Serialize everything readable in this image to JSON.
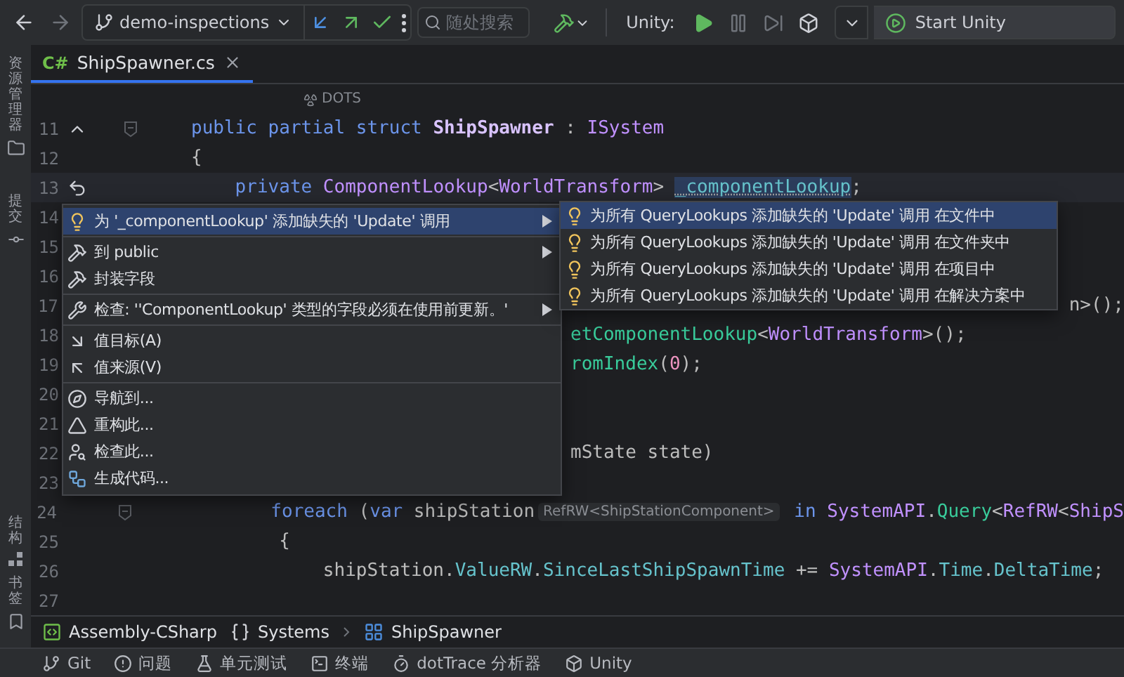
{
  "toolbar": {
    "branch": "demo-inspections",
    "search": {
      "placeholder": "随处搜索"
    },
    "unity_label": "Unity:",
    "start_button": "Start Unity"
  },
  "left_strip": [
    {
      "label": "资源管理器",
      "kind": "explorer"
    },
    {
      "label": "提交",
      "kind": "commit"
    },
    {
      "label": "结构",
      "kind": "structure"
    },
    {
      "label": "书签",
      "kind": "bookmarks"
    }
  ],
  "tabs": [
    {
      "badge": "C#",
      "label": "ShipSpawner.cs",
      "selected": true
    }
  ],
  "code_vision": "DOTS",
  "code_lines": [
    {
      "number": "11",
      "current": false,
      "kind": "implements",
      "tokens": [
        {
          "t": "public partial struct ",
          "kind": "kw"
        },
        {
          "t": "ShipSpawner",
          "kind": "decl"
        },
        {
          "t": " : ",
          "kind": "plain"
        },
        {
          "t": "ISystem",
          "kind": "type"
        }
      ]
    },
    {
      "number": "12",
      "current": false,
      "kind": "plain",
      "tokens": [
        {
          "t": "{",
          "kind": "plain"
        }
      ]
    },
    {
      "number": "13",
      "current": true,
      "kind": "revert",
      "tokens": [
        {
          "t": "    private ",
          "kind": "kw"
        },
        {
          "t": "ComponentLookup",
          "kind": "type"
        },
        {
          "t": "<",
          "kind": "plain"
        },
        {
          "t": "WorldTransform",
          "kind": "type"
        },
        {
          "t": "> ",
          "kind": "plain"
        },
        {
          "t": "_componentLookup",
          "kind": "field_hl"
        },
        {
          "t": ";",
          "kind": "plain"
        }
      ]
    },
    {
      "number": "14",
      "current": false,
      "kind": "plain"
    },
    {
      "number": "15",
      "current": false,
      "kind": "plain"
    },
    {
      "number": "16",
      "current": false,
      "kind": "plain"
    },
    {
      "number": "17",
      "current": false,
      "kind": "after_submenu",
      "tokens": [
        {
          "t": "n>();",
          "kind": "plain"
        }
      ]
    },
    {
      "number": "18",
      "current": false,
      "kind": "after_menu",
      "tokens": [
        {
          "t": "etComponentLookup",
          "kind": "method"
        },
        {
          "t": "<",
          "kind": "plain"
        },
        {
          "t": "WorldTransform",
          "kind": "type"
        },
        {
          "t": ">();",
          "kind": "plain"
        }
      ]
    },
    {
      "number": "19",
      "current": false,
      "kind": "after_menu",
      "tokens": [
        {
          "t": "romIndex",
          "kind": "method"
        },
        {
          "t": "(",
          "kind": "plain"
        },
        {
          "t": "0",
          "kind": "num"
        },
        {
          "t": ");",
          "kind": "plain"
        }
      ]
    },
    {
      "number": "20",
      "current": false,
      "kind": "plain"
    },
    {
      "number": "21",
      "current": false,
      "kind": "plain"
    },
    {
      "number": "22",
      "current": false,
      "kind": "after_menu",
      "tokens": [
        {
          "t": "mState state)",
          "kind": "plain"
        }
      ]
    },
    {
      "number": "23",
      "current": false,
      "kind": "plain"
    },
    {
      "number": "24",
      "current": false,
      "kind": "block",
      "tokens": [
        {
          "t": "        foreach",
          "kind": "kw"
        },
        {
          "t": " (",
          "kind": "plain"
        },
        {
          "t": "var",
          "kind": "kw"
        },
        {
          "t": " shipStation",
          "kind": "plain"
        },
        {
          "t": "RefRW<ShipStationComponent>",
          "kind": "hint"
        },
        {
          "t": " in ",
          "kind": "kw"
        },
        {
          "t": "SystemAPI",
          "kind": "type"
        },
        {
          "t": ".",
          "kind": "plain"
        },
        {
          "t": "Query",
          "kind": "method"
        },
        {
          "t": "<",
          "kind": "plain"
        },
        {
          "t": "RefRW",
          "kind": "type"
        },
        {
          "t": "<",
          "kind": "plain"
        },
        {
          "t": "ShipS",
          "kind": "type"
        }
      ]
    },
    {
      "number": "25",
      "current": false,
      "kind": "plain",
      "tokens": [
        {
          "t": "        {",
          "kind": "plain"
        }
      ]
    },
    {
      "number": "26",
      "current": false,
      "kind": "plain",
      "tokens": [
        {
          "t": "            shipStation.",
          "kind": "plain"
        },
        {
          "t": "ValueRW",
          "kind": "field"
        },
        {
          "t": ".",
          "kind": "plain"
        },
        {
          "t": "SinceLastShipSpawnTime",
          "kind": "field"
        },
        {
          "t": " += ",
          "kind": "plain"
        },
        {
          "t": "SystemAPI",
          "kind": "type"
        },
        {
          "t": ".",
          "kind": "plain"
        },
        {
          "t": "Time",
          "kind": "field"
        },
        {
          "t": ".",
          "kind": "plain"
        },
        {
          "t": "DeltaTime",
          "kind": "field"
        },
        {
          "t": ";",
          "kind": "plain"
        }
      ]
    },
    {
      "number": "27",
      "current": false,
      "kind": "plain"
    }
  ],
  "context_menu": [
    {
      "kind": "item",
      "label": "为 '_componentLookup' 添加缺失的 'Update' 调用",
      "submenu": true,
      "selected": true
    },
    {
      "kind": "separator"
    },
    {
      "kind": "item",
      "label": "到 public",
      "submenu": true,
      "selected": false
    },
    {
      "kind": "item",
      "label": "封装字段",
      "submenu": false,
      "selected": false
    },
    {
      "kind": "separator"
    },
    {
      "kind": "item",
      "label": "检查: ''ComponentLookup' 类型的字段必须在使用前更新。'",
      "submenu": true,
      "selected": false
    },
    {
      "kind": "separator"
    },
    {
      "kind": "item",
      "label": "值目标(A)",
      "submenu": false,
      "selected": false
    },
    {
      "kind": "item",
      "label": "值来源(V)",
      "submenu": false,
      "selected": false
    },
    {
      "kind": "separator"
    },
    {
      "kind": "item",
      "label": "导航到...",
      "submenu": false,
      "selected": false
    },
    {
      "kind": "item",
      "label": "重构此...",
      "submenu": false,
      "selected": false
    },
    {
      "kind": "item",
      "label": "检查此...",
      "submenu": false,
      "selected": false
    },
    {
      "kind": "item",
      "label": "生成代码...",
      "submenu": false,
      "selected": false
    }
  ],
  "submenu": [
    {
      "label": "为所有 QueryLookups 添加缺失的 'Update' 调用 在文件中",
      "selected": true
    },
    {
      "label": "为所有 QueryLookups 添加缺失的 'Update' 调用 在文件夹中",
      "selected": false
    },
    {
      "label": "为所有 QueryLookups 添加缺失的 'Update' 调用 在项目中",
      "selected": false
    },
    {
      "label": "为所有 QueryLookups 添加缺失的 'Update' 调用 在解决方案中",
      "selected": false
    }
  ],
  "breadcrumb": [
    {
      "label": "Assembly-CSharp",
      "kind": "assembly"
    },
    {
      "label": "Systems",
      "kind": "namespace"
    },
    {
      "label": "ShipSpawner",
      "kind": "struct"
    }
  ],
  "status_bar": [
    {
      "label": "Git",
      "kind": "git"
    },
    {
      "label": "问题",
      "kind": "problems"
    },
    {
      "label": "单元测试",
      "kind": "tests"
    },
    {
      "label": "终端",
      "kind": "terminal"
    },
    {
      "label": "dotTrace 分析器",
      "kind": "profiler"
    },
    {
      "label": "Unity",
      "kind": "unity"
    }
  ]
}
